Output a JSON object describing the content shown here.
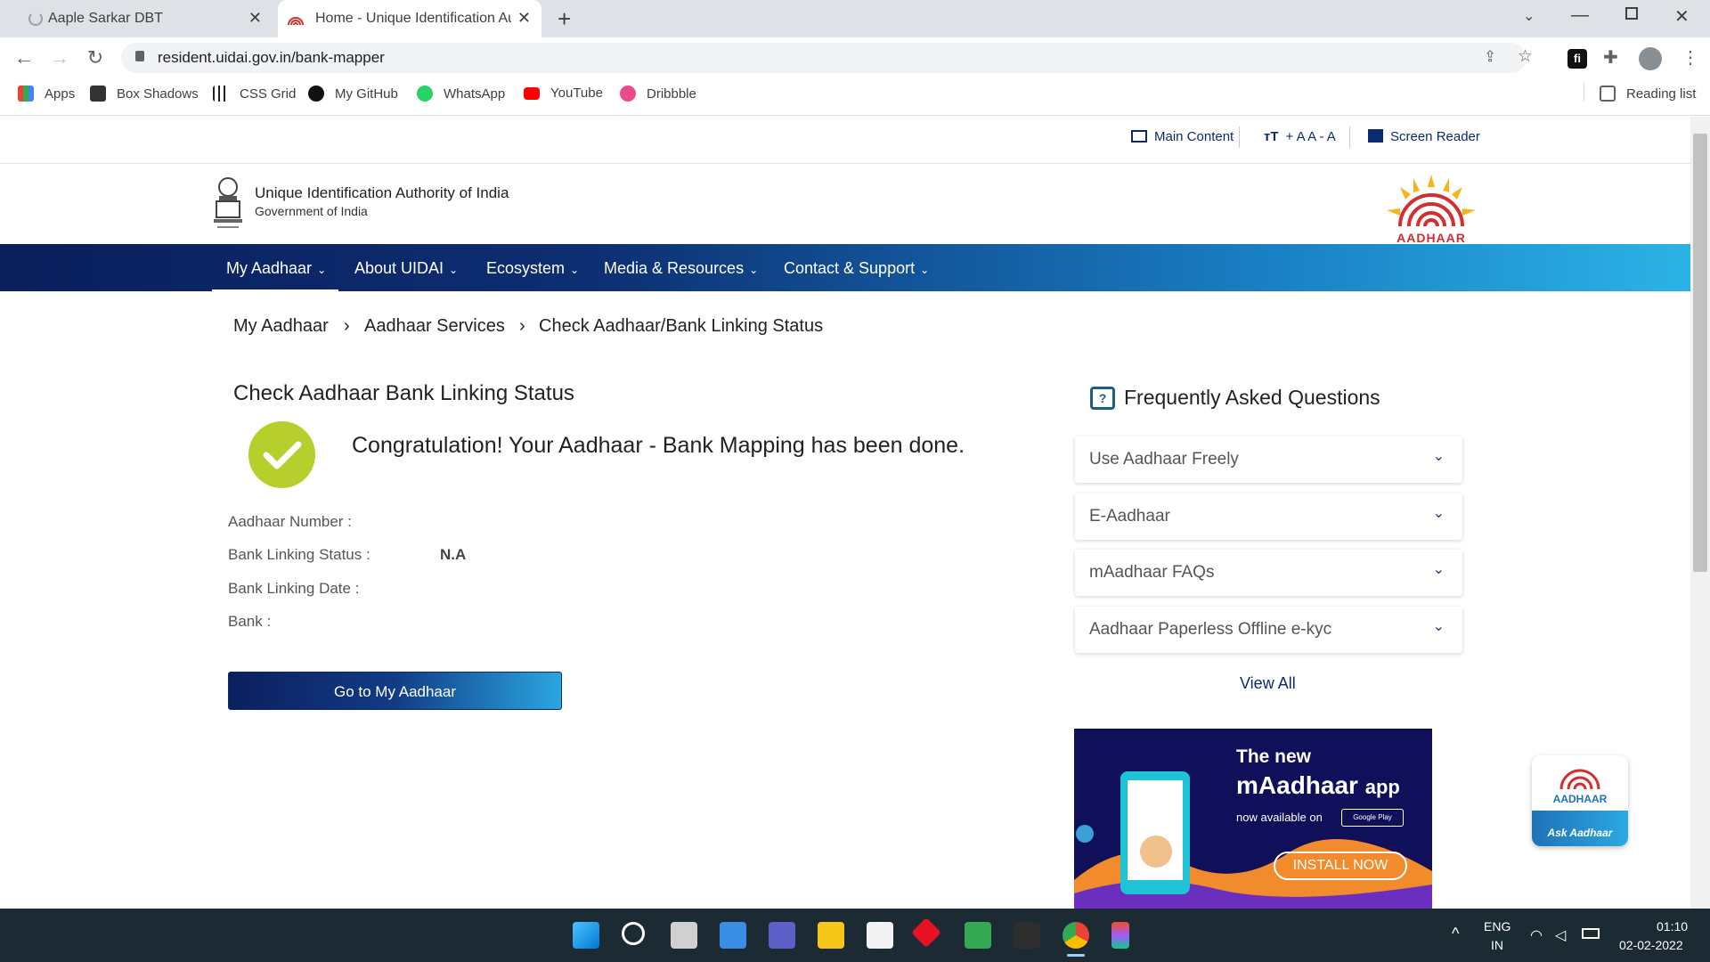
{
  "browser": {
    "tabs": [
      {
        "title": "Aaple Sarkar DBT",
        "close": "✕"
      },
      {
        "title": "Home - Unique Identification Au",
        "close": "✕"
      }
    ],
    "new_tab": "+",
    "url": "resident.uidai.gov.in/bank-mapper",
    "bookmarks": [
      {
        "label": "Apps",
        "color": "#4285f4"
      },
      {
        "label": "Box Shadows",
        "color": "#333333"
      },
      {
        "label": "CSS Grid",
        "color": "#222222"
      },
      {
        "label": "My GitHub",
        "color": "#111111"
      },
      {
        "label": "WhatsApp",
        "color": "#25d366"
      },
      {
        "label": "YouTube",
        "color": "#ff0000"
      },
      {
        "label": "Dribbble",
        "color": "#ea4c89"
      }
    ],
    "reading_list": "Reading list"
  },
  "utility": {
    "main_content": "Main Content",
    "font_size": "+ A A - A",
    "screen_reader": "Screen Reader"
  },
  "header": {
    "org": "Unique Identification Authority of India",
    "gov": "Government of India",
    "logo_text": "AADHAAR"
  },
  "nav": [
    {
      "label": "My Aadhaar"
    },
    {
      "label": "About UIDAI"
    },
    {
      "label": "Ecosystem"
    },
    {
      "label": "Media & Resources"
    },
    {
      "label": "Contact & Support"
    }
  ],
  "breadcrumb": [
    "My Aadhaar",
    "Aadhaar Services",
    "Check Aadhaar/Bank Linking Status"
  ],
  "main": {
    "title": "Check Aadhaar Bank Linking Status",
    "message": "Congratulation! Your Aadhaar - Bank Mapping has been done.",
    "fields": [
      {
        "label": "Aadhaar Number :",
        "value": ""
      },
      {
        "label": "Bank Linking Status :",
        "value": "N.A"
      },
      {
        "label": "Bank Linking Date :",
        "value": ""
      },
      {
        "label": "Bank :",
        "value": ""
      }
    ],
    "button": "Go to My Aadhaar"
  },
  "faq": {
    "title": "Frequently Asked Questions",
    "items": [
      "Use Aadhaar Freely",
      "E-Aadhaar",
      "mAadhaar FAQs",
      "Aadhaar Paperless Offline e-kyc"
    ],
    "view_all": "View All"
  },
  "promo": {
    "line1": "The new",
    "line2": "mAadhaar",
    "line2b": "app",
    "line3": "now available on",
    "store": "Google Play",
    "install": "INSTALL NOW"
  },
  "ask": {
    "brand": "AADHAAR",
    "label": "Ask Aadhaar"
  },
  "taskbar": {
    "lang1": "ENG",
    "lang2": "IN",
    "time": "01:10",
    "date": "02-02-2022"
  },
  "colors": {
    "accent": "#0b2a6f",
    "check": "#b6cf2c",
    "nav_start": "#0a1f5c",
    "nav_end": "#2bb3e6"
  }
}
